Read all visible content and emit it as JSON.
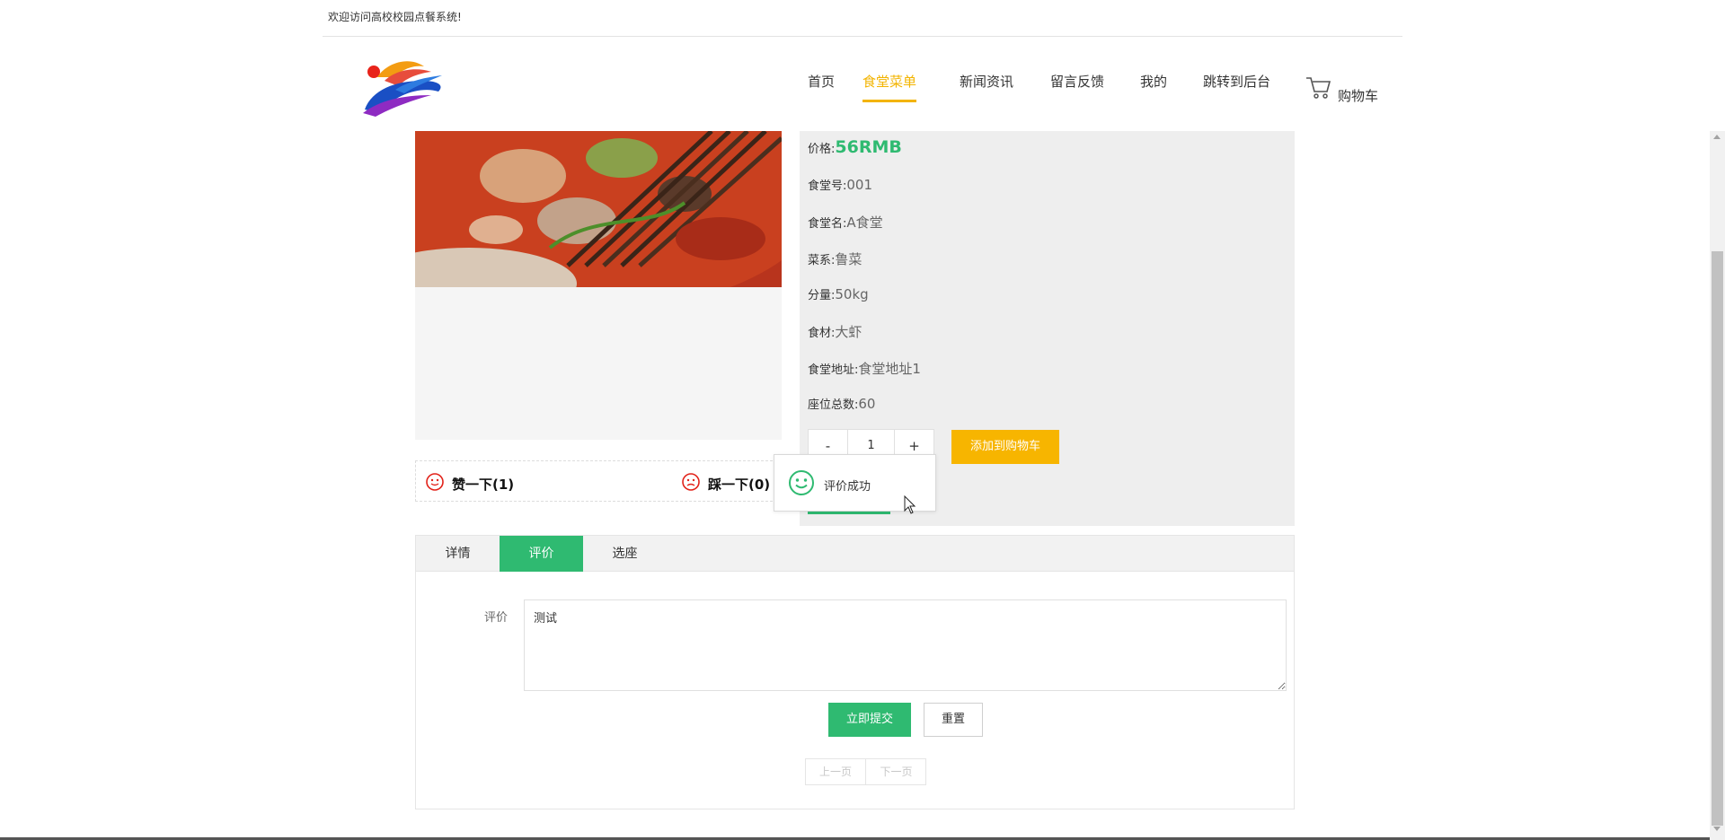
{
  "topbar": {
    "welcome": "欢迎访问高校校园点餐系统!"
  },
  "nav": {
    "items": [
      {
        "label": "首页",
        "active": false
      },
      {
        "label": "食堂菜单",
        "active": true
      },
      {
        "label": "新闻资讯",
        "active": false
      },
      {
        "label": "留言反馈",
        "active": false
      },
      {
        "label": "我的",
        "active": false
      },
      {
        "label": "跳转到后台",
        "active": false
      }
    ],
    "cart_label": "购物车"
  },
  "likes": {
    "like_label": "赞一下(1)",
    "dislike_label": "踩一下(0)"
  },
  "details": {
    "price_label": "价格:",
    "price_value": "56RMB",
    "canteen_no_label": "食堂号:",
    "canteen_no": "001",
    "canteen_name_label": "食堂名:",
    "canteen_name": "A食堂",
    "cuisine_label": "菜系:",
    "cuisine": "鲁菜",
    "portion_label": "分量:",
    "portion": "50kg",
    "ingredient_label": "食材:",
    "ingredient": "大虾",
    "address_label": "食堂地址:",
    "address": "食堂地址1",
    "seats_label": "座位总数:",
    "seats": "60"
  },
  "quantity": {
    "minus": "-",
    "value": "1",
    "plus": "+"
  },
  "add_to_cart": "添加到购物车",
  "toast": {
    "message": "评价成功"
  },
  "tabs": [
    {
      "label": "详情",
      "active": false
    },
    {
      "label": "评价",
      "active": true
    },
    {
      "label": "选座",
      "active": false
    }
  ],
  "review": {
    "label": "评价",
    "value": "测试",
    "submit": "立即提交",
    "reset": "重置"
  },
  "pager": {
    "prev": "上一页",
    "next": "下一页"
  },
  "colors": {
    "accent_green": "#2fba71",
    "accent_orange": "#f7b500",
    "nav_active": "#f3b400"
  }
}
